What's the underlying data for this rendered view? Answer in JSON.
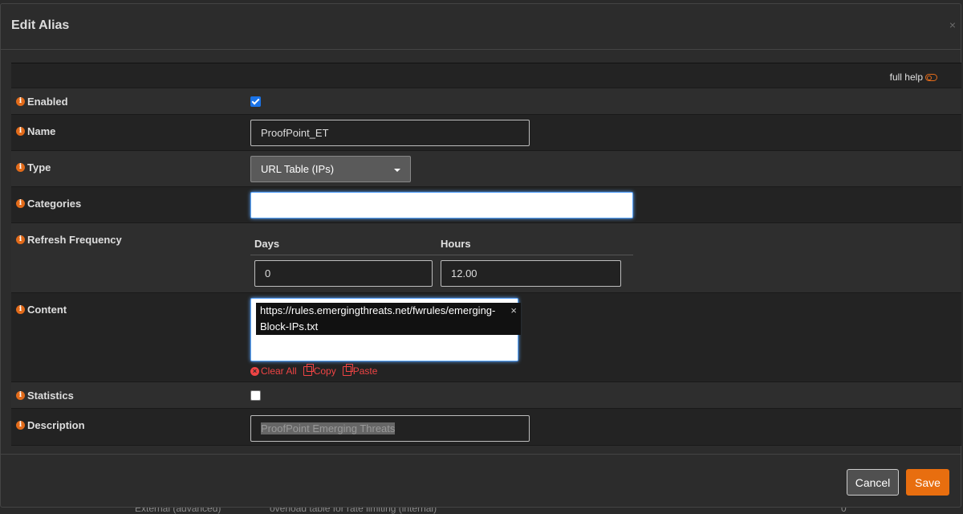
{
  "background": {
    "row_col1": "External (advanced)",
    "row_col2": "overload table for rate limiting (internal)",
    "row_col3": "0"
  },
  "modal": {
    "title": "Edit Alias",
    "close_glyph": "×"
  },
  "help": {
    "label": "full help"
  },
  "fields": {
    "enabled": {
      "label": "Enabled",
      "checked": true
    },
    "name": {
      "label": "Name",
      "value": "ProofPoint_ET"
    },
    "type": {
      "label": "Type",
      "value": "URL Table (IPs)"
    },
    "categories": {
      "label": "Categories",
      "value": ""
    },
    "refresh": {
      "label": "Refresh Frequency",
      "days_label": "Days",
      "hours_label": "Hours",
      "days_value": "0",
      "hours_value": "12.00"
    },
    "content": {
      "label": "Content",
      "tag_line1": "https://rules.emergingthreats.net/fwrules/emerging-",
      "tag_line2": "Block-IPs.txt",
      "tag_remove": "×",
      "clear_all": "Clear All",
      "copy": "Copy",
      "paste": "Paste"
    },
    "statistics": {
      "label": "Statistics",
      "checked": false
    },
    "description": {
      "label": "Description",
      "value": "ProofPoint Emerging Threats"
    }
  },
  "footer": {
    "cancel_label": "Cancel",
    "save_label": "Save"
  },
  "colors": {
    "accent": "#e86e0f",
    "info_icon": "#e26b1a",
    "checkbox_on": "#1a73e8",
    "danger_link": "#ee4444"
  },
  "icons": {
    "info": "info-circle-icon",
    "toggle": "toggle-icon",
    "clear": "times-circle-icon",
    "copy": "copy-icon",
    "paste": "paste-icon",
    "close": "close-icon",
    "caret": "caret-down-icon"
  }
}
